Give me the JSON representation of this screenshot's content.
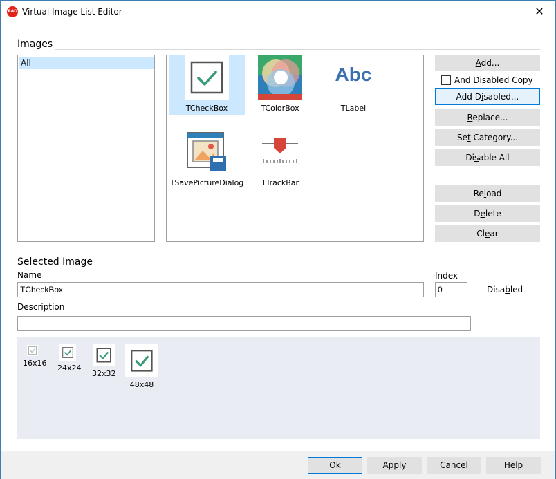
{
  "window": {
    "title": "Virtual Image List Editor",
    "app_icon_text": "RAD",
    "close_glyph": "✕"
  },
  "images_group": {
    "label": "Images",
    "categories": [
      "All"
    ],
    "items": [
      {
        "caption": "TCheckBox",
        "icon": "checkbox-icon",
        "selected": true
      },
      {
        "caption": "TColorBox",
        "icon": "colorbox-icon",
        "selected": false
      },
      {
        "caption": "TLabel",
        "icon": "label-abc-icon",
        "label_text": "Abc",
        "selected": false
      },
      {
        "caption": "TSavePictureDialog",
        "icon": "save-picture-dialog-icon",
        "selected": false
      },
      {
        "caption": "TTrackBar",
        "icon": "trackbar-icon",
        "selected": false
      }
    ]
  },
  "buttons": {
    "add": {
      "pre": "",
      "u": "A",
      "post": "dd..."
    },
    "and_disabled_copy": {
      "pre": "And Disabled ",
      "u": "C",
      "post": "opy",
      "checked": false
    },
    "add_disabled": {
      "pre": "Add D",
      "u": "i",
      "post": "sabled..."
    },
    "replace": {
      "pre": "",
      "u": "R",
      "post": "eplace..."
    },
    "set_category": {
      "pre": "Se",
      "u": "t",
      "post": " Category..."
    },
    "disable_all": {
      "pre": "Di",
      "u": "s",
      "post": "able All"
    },
    "reload": {
      "pre": "Re",
      "u": "l",
      "post": "oad"
    },
    "delete": {
      "pre": "D",
      "u": "e",
      "post": "lete"
    },
    "clear": {
      "pre": "Cl",
      "u": "e",
      "post": "ar"
    }
  },
  "selected_image": {
    "group_label": "Selected Image",
    "name_label": "Name",
    "name_value": "TCheckBox",
    "index_label": "Index",
    "index_value": "0",
    "disabled": {
      "pre": "Disa",
      "u": "b",
      "post": "led",
      "checked": false
    },
    "description_label": "Description",
    "description_value": "",
    "previews": [
      "16x16",
      "24x24",
      "32x32",
      "48x48"
    ]
  },
  "footer": {
    "ok": {
      "pre": "",
      "u": "O",
      "post": "k"
    },
    "apply": "Apply",
    "cancel": "Cancel",
    "help": {
      "pre": "",
      "u": "H",
      "post": "elp"
    }
  },
  "colors": {
    "accent": "#0078d7",
    "selection": "#cce8ff",
    "check_green": "#3a9a7a",
    "label_blue": "#3a6fb0"
  }
}
